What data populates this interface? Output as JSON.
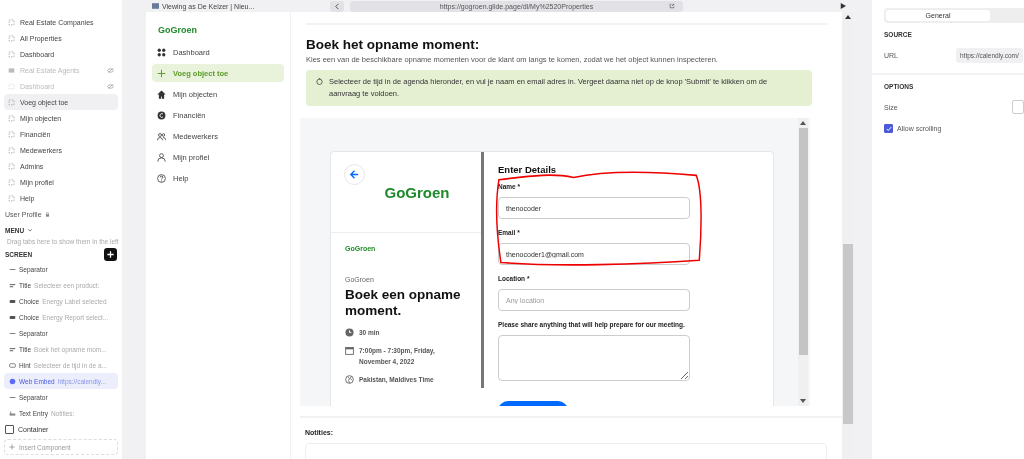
{
  "builder": {
    "tabs": [
      {
        "label": "Real Estate Companies",
        "hidden": false,
        "selected": false,
        "kind": "screen"
      },
      {
        "label": "All Properties",
        "hidden": false,
        "selected": false,
        "kind": "screen"
      },
      {
        "label": "Dashboard",
        "hidden": false,
        "selected": false,
        "kind": "screen"
      },
      {
        "label": "Real Estate Agents",
        "hidden": true,
        "selected": false,
        "kind": "list"
      },
      {
        "label": "Dashboard",
        "hidden": true,
        "selected": false,
        "kind": "screen"
      },
      {
        "label": "Voeg object toe",
        "hidden": false,
        "selected": true,
        "kind": "screen"
      },
      {
        "label": "Mijn objecten",
        "hidden": false,
        "selected": false,
        "kind": "screen"
      },
      {
        "label": "Financiën",
        "hidden": false,
        "selected": false,
        "kind": "screen"
      },
      {
        "label": "Medewerkers",
        "hidden": false,
        "selected": false,
        "kind": "screen"
      },
      {
        "label": "Admins",
        "hidden": false,
        "selected": false,
        "kind": "screen"
      },
      {
        "label": "Mijn profiel",
        "hidden": false,
        "selected": false,
        "kind": "screen"
      },
      {
        "label": "Help",
        "hidden": false,
        "selected": false,
        "kind": "screen"
      }
    ],
    "user_profile": "User Profile",
    "menu": "MENU",
    "menu_hint": "Drag tabs here to show them in the left",
    "screen_label": "SCREEN",
    "components": [
      {
        "kind": "separator",
        "type": "Separator",
        "selected": false
      },
      {
        "kind": "title",
        "type": "Title",
        "detail": "Selecteer een product:",
        "selected": false
      },
      {
        "kind": "choice",
        "type": "Choice",
        "detail": "Energy Label selected",
        "selected": false
      },
      {
        "kind": "choice",
        "type": "Choice",
        "detail": "Energy Report select...",
        "selected": false
      },
      {
        "kind": "separator",
        "type": "Separator",
        "selected": false
      },
      {
        "kind": "title",
        "type": "Title",
        "detail": "Boek het opname mom...",
        "selected": false
      },
      {
        "kind": "hint",
        "type": "Hint",
        "detail": "Selecteer de tijd in de a...",
        "selected": false
      },
      {
        "kind": "embed",
        "type": "Web Embed",
        "detail": "https://calendly...",
        "selected": true
      },
      {
        "kind": "separator",
        "type": "Separator",
        "selected": false
      },
      {
        "kind": "entry",
        "type": "Text Entry",
        "detail": "Notities:",
        "selected": false
      }
    ],
    "container": "Container",
    "insert_placeholder": "Insert Component"
  },
  "preview": {
    "viewing_as": "Viewing as De Keizer | Nieu...",
    "url": "https://gogroen.glide.page/dl/My%2520Properties",
    "app": {
      "brand": "GoGroen",
      "nav": [
        {
          "label": "Dashboard",
          "selected": false
        },
        {
          "label": "Voeg object toe",
          "selected": true
        },
        {
          "label": "Mijn objecten",
          "selected": false
        },
        {
          "label": "Financiën",
          "selected": false
        },
        {
          "label": "Medewerkers",
          "selected": false
        },
        {
          "label": "Mijn profiel",
          "selected": false
        },
        {
          "label": "Help",
          "selected": false
        }
      ],
      "title": "Boek het opname moment:",
      "subtitle": "Kies een van de beschikbare opname momenten voor de klant om langs te komen, zodat we het object kunnen inspecteren.",
      "hint": "Selecteer de tijd in de agenda hieronder, en vul je naam en email adres in. Vergeet daarna niet op de knop 'Submit' te klikken om de aanvraag te voldoen.",
      "embed": {
        "logo": "GoGroen",
        "small_logo": "GoGroen",
        "organizer": "GoGroen",
        "event": "Boek een opname moment.",
        "duration": "30 min",
        "when": "7:00pm - 7:30pm, Friday, November 4, 2022",
        "timezone": "Pakistan, Maldives Time",
        "heading": "Enter Details",
        "fields": [
          {
            "kind": "input",
            "label": "Name *",
            "value": "thenocoder"
          },
          {
            "kind": "input",
            "label": "Email *",
            "value": "thenocoder1@gmail.com"
          },
          {
            "kind": "input",
            "label": "Location *",
            "placeholder": "Any location"
          },
          {
            "kind": "textarea",
            "label": "Please share anything that will help prepare for our meeting."
          }
        ]
      },
      "notes_label": "Notities:"
    }
  },
  "inspector": {
    "tabs": [
      {
        "label": "General",
        "selected": true
      }
    ],
    "source": "SOURCE",
    "url_label": "URL",
    "url_value": "https://calendly.com/",
    "options": "OPTIONS",
    "size_label": "Size",
    "allow_scrolling": {
      "label": "Allow scrolling",
      "checked": true
    }
  }
}
